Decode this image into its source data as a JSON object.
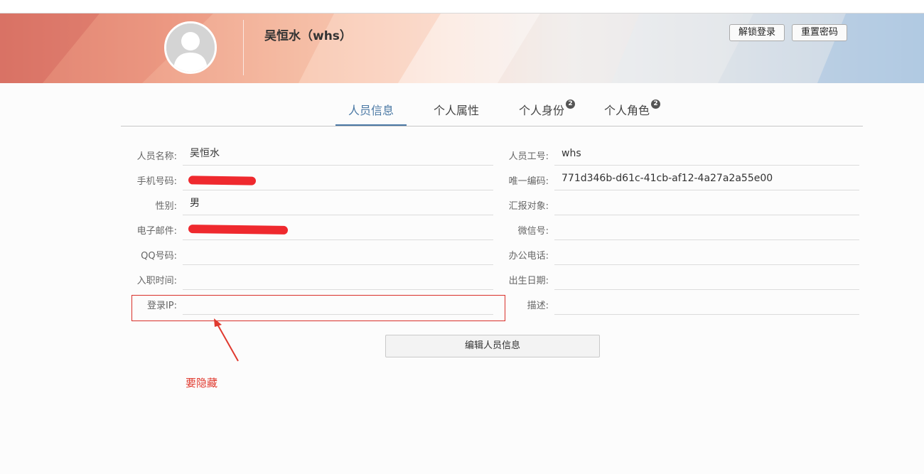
{
  "header": {
    "person_name": "吴恒水（whs）",
    "unlock_label": "解锁登录",
    "reset_label": "重置密码"
  },
  "tabs": [
    {
      "label": "人员信息",
      "active": true,
      "badge": ""
    },
    {
      "label": "个人属性",
      "active": false,
      "badge": ""
    },
    {
      "label": "个人身份",
      "active": false,
      "badge": "2"
    },
    {
      "label": "个人角色",
      "active": false,
      "badge": "2"
    }
  ],
  "left_fields": [
    {
      "label": "人员名称:",
      "value": "吴恒水"
    },
    {
      "label": "手机号码:",
      "value": ""
    },
    {
      "label": "性别:",
      "value": "男"
    },
    {
      "label": "电子邮件:",
      "value": ""
    },
    {
      "label": "QQ号码:",
      "value": ""
    },
    {
      "label": "入职时间:",
      "value": ""
    },
    {
      "label": "登录IP:",
      "value": ""
    }
  ],
  "right_fields": [
    {
      "label": "人员工号:",
      "value": "whs"
    },
    {
      "label": "唯一编码:",
      "value": "771d346b-d61c-41cb-af12-4a27a2a55e00"
    },
    {
      "label": "汇报对象:",
      "value": ""
    },
    {
      "label": "微信号:",
      "value": ""
    },
    {
      "label": "办公电话:",
      "value": ""
    },
    {
      "label": "出生日期:",
      "value": ""
    },
    {
      "label": "描述:",
      "value": ""
    }
  ],
  "edit_button_label": "编辑人员信息",
  "annotation_text": "要隐藏",
  "colors": {
    "accent": "#4a78a4",
    "annotation": "#e03a2f",
    "redaction": "#ee1d23"
  },
  "icons": {
    "avatar": "user-silhouette-icon",
    "tab_badge": "numbered-badge-icon",
    "arrow": "annotation-arrow-icon"
  }
}
